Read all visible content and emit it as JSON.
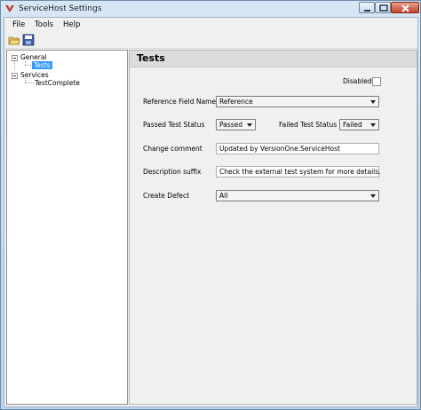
{
  "window": {
    "title": "ServiceHost Settings",
    "controls": [
      "minimize-icon",
      "maximize-icon",
      "close-icon"
    ]
  },
  "menu": {
    "items": [
      {
        "label": "File"
      },
      {
        "label": "Tools"
      },
      {
        "label": "Help"
      }
    ]
  },
  "toolbar": {
    "buttons": [
      {
        "icon": "open-folder-icon"
      },
      {
        "icon": "save-icon"
      }
    ]
  },
  "tree": {
    "nodes": [
      {
        "label": "General",
        "children": [
          {
            "label": "Tests",
            "selected": true
          }
        ]
      },
      {
        "label": "Services",
        "children": [
          {
            "label": "TestComplete"
          }
        ]
      }
    ]
  },
  "panel": {
    "title": "Tests",
    "disabled": {
      "label": "Disabled",
      "checked": false
    },
    "reference_field": {
      "label": "Reference Field Name",
      "value": "Reference"
    },
    "passed_status": {
      "label": "Passed Test Status",
      "value": "Passed"
    },
    "failed_status": {
      "label": "Failed Test Status",
      "value": "Failed"
    },
    "change_comment": {
      "label": "Change comment",
      "value": "Updated by VersionOne.ServiceHost"
    },
    "description_suffix": {
      "label": "Description suffix",
      "value": "Check the external test system for more details."
    },
    "create_defect": {
      "label": "Create Defect",
      "value": "All"
    }
  },
  "colors": {
    "selection": "#3399ff",
    "panel_header": "#dcdcdc",
    "window_frame": "#bcd3ea"
  }
}
